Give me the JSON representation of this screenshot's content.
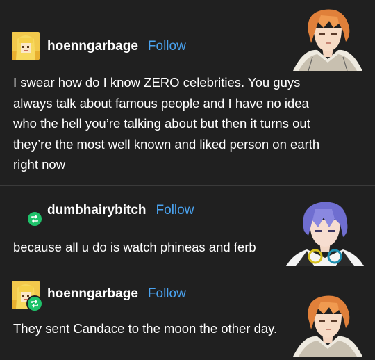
{
  "posts": [
    {
      "username": "hoenngarbage",
      "follow_label": "Follow",
      "text_lines": [
        "I swear how do I know ZERO celebrities. You guys",
        "always talk about famous people and I have no idea",
        "who the hell you’re talking about but then it turns out",
        "they’re the most well known and liked person on earth",
        "right now"
      ]
    },
    {
      "username": "dumbhairybitch",
      "follow_label": "Follow",
      "text_lines": [
        "because all u do is watch phineas and ferb"
      ]
    },
    {
      "username": "hoenngarbage",
      "follow_label": "Follow",
      "text_lines": [
        "They sent Candace to the moon the other day."
      ]
    }
  ],
  "icons": {
    "reblog": "reblog-icon",
    "avatar_blonde": "blonde-girl-avatar",
    "character_orange": "orange-haired-character",
    "character_purple": "purple-haired-character"
  },
  "colors": {
    "background": "#202020",
    "follow": "#4aa3f0",
    "reblog_badge": "#1ec26a",
    "divider": "#3a3a3a"
  }
}
